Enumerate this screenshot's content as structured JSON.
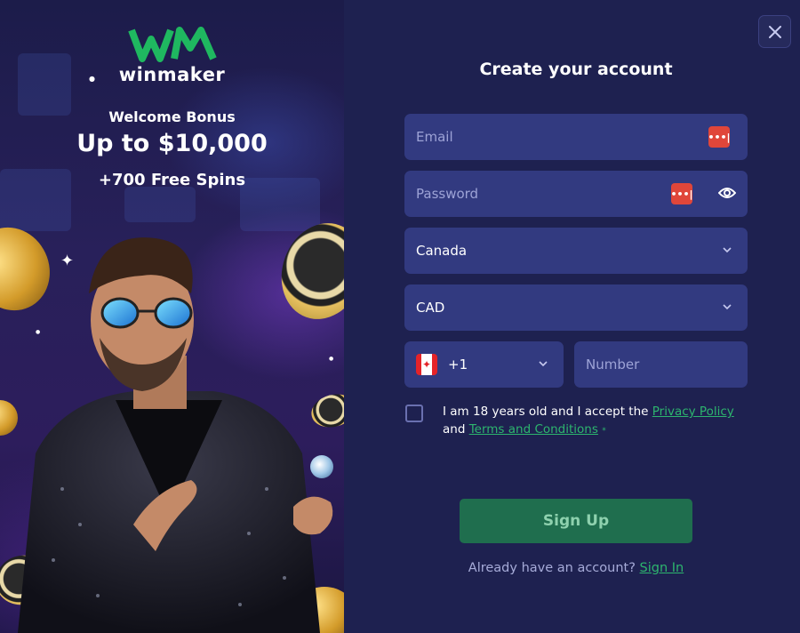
{
  "promo": {
    "logo_text": "winmaker",
    "bonus_title": "Welcome Bonus",
    "bonus_amount": "Up to $10,000",
    "bonus_spins": "+700 Free Spins"
  },
  "form": {
    "heading": "Create your account",
    "email_placeholder": "Email",
    "password_placeholder": "Password",
    "country_value": "Canada",
    "currency_value": "CAD",
    "phone_code": "+1",
    "number_placeholder": "Number",
    "consent_prefix": "I am 18 years old and I accept the",
    "privacy_link": "Privacy Policy",
    "consent_and": "and",
    "terms_link": "Terms and Conditions",
    "required_mark": "*",
    "signup_label": "Sign Up",
    "signin_prefix": "Already have an account?",
    "signin_link": "Sign In",
    "password_manager_glyph": "•••|"
  },
  "colors": {
    "brand_green": "#2db56e",
    "panel_bg": "#1e2150",
    "field_bg": "#323a80",
    "signup_bg": "#1f6e4e",
    "password_icon": "#e0463a"
  },
  "icons": [
    "close-icon",
    "password-manager-icon",
    "eye-icon",
    "chevron-down-icon",
    "canada-flag-icon"
  ]
}
